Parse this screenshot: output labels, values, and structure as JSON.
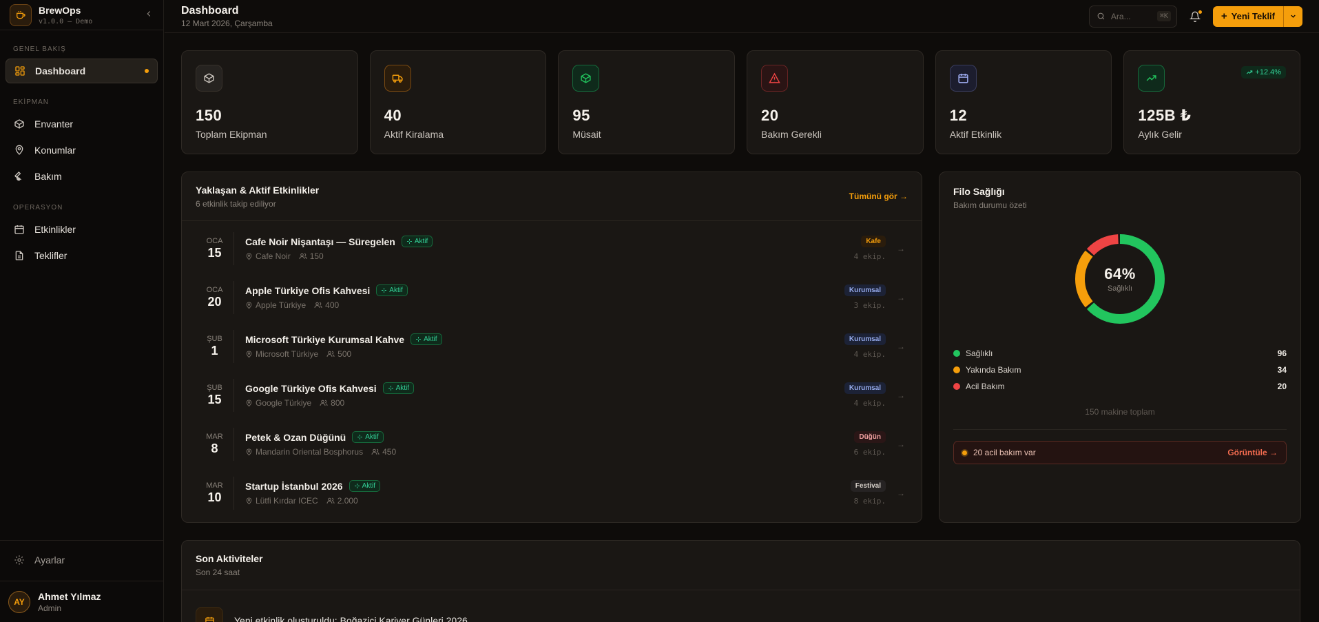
{
  "brand": {
    "name": "BrewOps",
    "version": "v1.0.0 — Demo"
  },
  "nav": {
    "sections": [
      {
        "title": "GENEL BAKIŞ",
        "items": [
          {
            "label": "Dashboard",
            "icon": "grid-icon"
          }
        ]
      },
      {
        "title": "EKİPMAN",
        "items": [
          {
            "label": "Envanter",
            "icon": "box-icon"
          },
          {
            "label": "Konumlar",
            "icon": "map-pin-icon"
          },
          {
            "label": "Bakım",
            "icon": "wrench-icon"
          }
        ]
      },
      {
        "title": "OPERASYON",
        "items": [
          {
            "label": "Etkinlikler",
            "icon": "calendar-icon"
          },
          {
            "label": "Teklifler",
            "icon": "document-icon"
          }
        ]
      }
    ],
    "settings": "Ayarlar"
  },
  "user": {
    "initials": "AY",
    "name": "Ahmet Yılmaz",
    "role": "Admin"
  },
  "header": {
    "title": "Dashboard",
    "date": "12 Mart 2026, Çarşamba",
    "search_placeholder": "Ara...",
    "search_shortcut": "⌘K",
    "new_quote": "Yeni Teklif"
  },
  "stats": [
    {
      "value": "150",
      "label": "Toplam Ekipman",
      "icon": "package-icon",
      "color": "#cbc5be"
    },
    {
      "value": "40",
      "label": "Aktif Kiralama",
      "icon": "truck-icon",
      "color": "#f59e0b"
    },
    {
      "value": "95",
      "label": "Müsait",
      "icon": "package-check-icon",
      "color": "#22c55e"
    },
    {
      "value": "20",
      "label": "Bakım Gerekli",
      "icon": "warning-icon",
      "color": "#ef4444"
    },
    {
      "value": "12",
      "label": "Aktif Etkinlik",
      "icon": "calendar-icon",
      "color": "#818cf8"
    },
    {
      "value": "125B ₺",
      "label": "Aylık Gelir",
      "icon": "trending-up-icon",
      "color": "#22c55e",
      "trend": "+12.4%"
    }
  ],
  "events": {
    "title": "Yaklaşan & Aktif Etkinlikler",
    "subtitle": "6 etkinlik takip ediliyor",
    "view_all": "Tümünü gör →",
    "items": [
      {
        "month": "OCA",
        "day": "15",
        "title": "Cafe Noir Nişantaşı — Süregelen",
        "status": "Aktif",
        "location": "Cafe Noir",
        "guests": "150",
        "tag": "Kafe",
        "tag_class": "kafe",
        "ekip": "4 ekip."
      },
      {
        "month": "OCA",
        "day": "20",
        "title": "Apple Türkiye Ofis Kahvesi",
        "status": "Aktif",
        "location": "Apple Türkiye",
        "guests": "400",
        "tag": "Kurumsal",
        "tag_class": "kurumsal",
        "ekip": "3 ekip."
      },
      {
        "month": "ŞUB",
        "day": "1",
        "title": "Microsoft Türkiye Kurumsal Kahve",
        "status": "Aktif",
        "location": "Microsoft Türkiye",
        "guests": "500",
        "tag": "Kurumsal",
        "tag_class": "kurumsal",
        "ekip": "4 ekip."
      },
      {
        "month": "ŞUB",
        "day": "15",
        "title": "Google Türkiye Ofis Kahvesi",
        "status": "Aktif",
        "location": "Google Türkiye",
        "guests": "800",
        "tag": "Kurumsal",
        "tag_class": "kurumsal",
        "ekip": "4 ekip."
      },
      {
        "month": "MAR",
        "day": "8",
        "title": "Petek & Ozan Düğünü",
        "status": "Aktif",
        "location": "Mandarin Oriental Bosphorus",
        "guests": "450",
        "tag": "Düğün",
        "tag_class": "dugun",
        "ekip": "6 ekip."
      },
      {
        "month": "MAR",
        "day": "10",
        "title": "Startup İstanbul 2026",
        "status": "Aktif",
        "location": "Lütfi Kırdar ICEC",
        "guests": "2.000",
        "tag": "Festival",
        "tag_class": "festival",
        "ekip": "8 ekip."
      }
    ]
  },
  "fleet": {
    "title": "Filo Sağlığı",
    "subtitle": "Bakım durumu özeti",
    "percent": "64%",
    "percent_label": "Sağlıklı",
    "segments": [
      {
        "label": "Sağlıklı",
        "value": 96,
        "color": "#22c55e"
      },
      {
        "label": "Yakında Bakım",
        "value": 34,
        "color": "#f59e0b"
      },
      {
        "label": "Acil Bakım",
        "value": 20,
        "color": "#ef4444"
      }
    ],
    "total": "150 makine toplam",
    "alert_text": "20 acil bakım var",
    "alert_link": "Görüntüle →"
  },
  "activities": {
    "title": "Son Aktiviteler",
    "subtitle": "Son 24 saat",
    "items": [
      {
        "text": "Yeni etkinlik oluşturuldu: Boğaziçi Kariyer Günleri 2026",
        "icon": "calendar-icon"
      }
    ]
  }
}
